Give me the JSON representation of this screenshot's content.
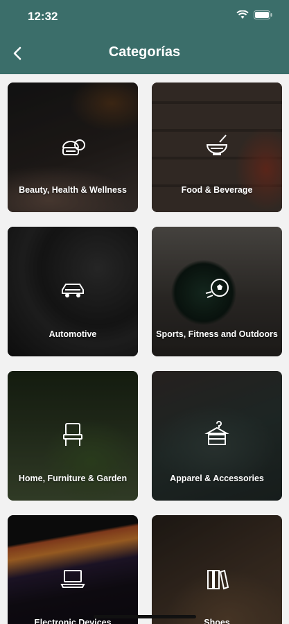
{
  "status_bar": {
    "time": "12:32"
  },
  "header": {
    "title": "Categorías"
  },
  "categories": [
    {
      "label": "Beauty, Health & Wellness",
      "icon": "beauty-icon"
    },
    {
      "label": "Food & Beverage",
      "icon": "bowl-icon"
    },
    {
      "label": "Automotive",
      "icon": "car-icon"
    },
    {
      "label": "Sports, Fitness and Outdoors",
      "icon": "soccer-ball-icon"
    },
    {
      "label": "Home, Furniture & Garden",
      "icon": "chair-icon"
    },
    {
      "label": "Apparel & Accessories",
      "icon": "clothes-icon"
    },
    {
      "label": "Electronic Devices",
      "icon": "laptop-icon"
    },
    {
      "label": "Shoes",
      "icon": "books-icon"
    }
  ],
  "colors": {
    "header": "#3b6e6a",
    "background": "#f2f2f2"
  }
}
